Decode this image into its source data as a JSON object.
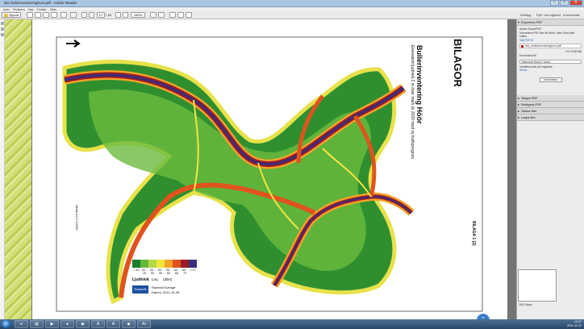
{
  "window": {
    "title": "bbc bullerinventeringhoor.pdf - Adobe Reader",
    "min": "–",
    "max": "□",
    "close": "✕"
  },
  "menu": [
    "Arkiv",
    "Redigera",
    "Visa",
    "Fönster",
    "Hjälp"
  ],
  "toolbar": {
    "open_label": "Öppna",
    "page_current": "17",
    "page_total": "/ 18",
    "zoom": "150%",
    "tab_tools": "Verktyg",
    "tab_sign": "Fyll i och signera",
    "tab_comment": "Kommentar"
  },
  "pane": {
    "section1": "Exportera PDF",
    "export_service": "Adobe ExportPDF",
    "export_desc": "Konvertera PDF-filer till Word- eller Excel-filer online.",
    "select_file_link": "Välj PDF-fil",
    "file_name": "bbc_bullerinventeringhoor.pdf",
    "file_count": "1 fil / 5,68 MB",
    "convert_to_label": "Konvertera till",
    "format_value": "Microsoft Word (*.docx)",
    "ocr_label": "Identifiera text på engelska",
    "ocr_link": "Ändra",
    "convert_button": "Konvertera",
    "section2": "Skapa PDF",
    "section3": "Redigera PDF",
    "section4": "Skicka filer",
    "section5": "Lagra filer",
    "footer": "2011 Mapo"
  },
  "document": {
    "heading": "BILAGOR",
    "title": "Bullerinventering Höör",
    "subtitle": "Ekvivalent ljudnivå 2 m över mark år 2020 med ny trafikprognos",
    "scale": "Skala A4 1:12000",
    "legend_title": "Ljudnivå",
    "legend_sub": "Leq",
    "legend_unit": "(dBA)",
    "legend_items": [
      "< 40",
      "40 - 45",
      "45 - 50",
      "50 - 55",
      "55 - 60",
      "60 - 65",
      "65 - 70",
      "> 70"
    ],
    "legend_colors": [
      "#1a7f2a",
      "#66b83a",
      "#b5d84a",
      "#f2e541",
      "#f2a22a",
      "#e0531e",
      "#9b1b26",
      "#3a2d7a"
    ],
    "appendix": "BILAGA 1 (2)",
    "brand": "Ramböll",
    "brand_sub": "Ramböll Sverige",
    "date": "Datum: 2011-10-28"
  },
  "taskbar": {
    "time": "10:07",
    "date": "2011-11-21"
  }
}
